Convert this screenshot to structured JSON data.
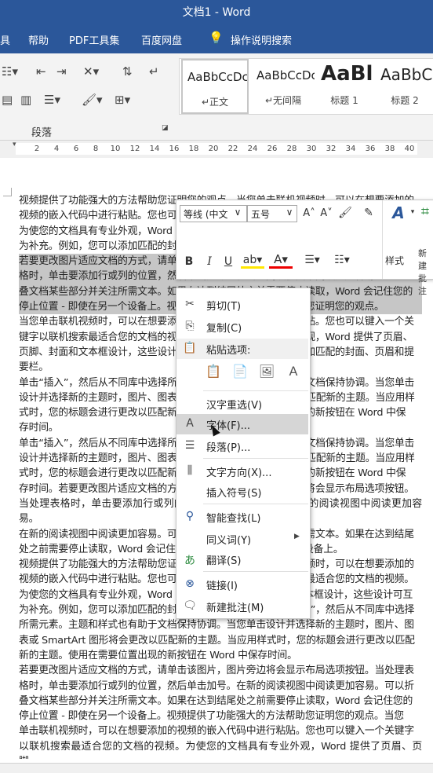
{
  "window": {
    "title": "文档1 - Word"
  },
  "menubar": {
    "items": [
      "具",
      "帮助",
      "PDF工具集",
      "百度网盘",
      "操作说明搜索"
    ]
  },
  "ribbon": {
    "paragraph_label": "段落",
    "styles": [
      {
        "sample": "AaBbCcDc",
        "name": "↵正文"
      },
      {
        "sample": "AaBbCcDc",
        "name": "↵无间隔"
      },
      {
        "sample": "AaBl",
        "name": "标题 1"
      },
      {
        "sample": "AaBbC",
        "name": "标题 2"
      }
    ]
  },
  "ruler": {
    "ticks": [
      "2",
      "4",
      "6",
      "8",
      "10",
      "12",
      "14",
      "16",
      "18",
      "20",
      "22",
      "24",
      "26",
      "28",
      "30",
      "32",
      "34",
      "36",
      "38",
      "40"
    ]
  },
  "document": {
    "lines": [
      "视频提供了功能强大的方法帮助您证明您的观点。当您单击联机视频时，可以在想要添加的",
      "视频的嵌入代码中进行粘贴。您也可以键入一个关键字以联机搜索最适合您的文档的视频。",
      "为使您的文档具有专业外观，Word 提供了页眉、页脚、封面和文本框设计，这些设计可互",
      "为补充。例如，您可以添加匹配的封面、页眉和提要栏。单击“插入”，然后从不同库中选择",
      "若要更改图片适应文档的方式，请单击该图片，图片旁边将会显示布局选项按钮。当处理表",
      "格时，单击要添加行或列的位置，然后单击加号。在新的阅读视图中阅读更加容易。可以折",
      "叠文档某些部分并关注所需文本。如果在达到结尾处之前需要停止读取，Word 会记住您的",
      "停止位置 - 即使在另一个设备上。视频提供了功能强大的方法帮助您证明您的观点。",
      "当您单击联机视频时，可以在想要添加的视频的嵌入代码中进行粘贴。您也可以键入一个关",
      "键字以联机搜索最适合您的文档的视频。为使您的文档具有专业外观，Word 提供了页眉、",
      "页脚、封面和文本框设计，这些设计可互为补充。例如，您可以添加匹配的封面、页眉和提",
      "要栏。",
      "单击“插入”，然后从不同库中选择所需元素。主题和样式也有助于文档保持协调。当您单击",
      "设计并选择新的主题时，图片、图表或 SmartArt 图形将会更改以匹配新的主题。当应用样",
      "式时，您的标题会进行更改以匹配新的主题。使用在需要位置出现的新按钮在 Word 中保",
      "存时间。",
      "单击“插入”，然后从不同库中选择所需元素。主题和样式也有助于文档保持协调。当您单击",
      "设计并选择新的主题时，图片、图表或 SmartArt 图形将会更改以匹配新的主题。当应用样",
      "式时，您的标题会进行更改以匹配新的主题。使用在需要位置出现的新按钮在 Word 中保",
      "存时间。若要更改图片适应文档的方式，请单击该图片，图片旁边将会显示布局选项按钮。",
      "当处理表格时，单击要添加行或列的位置，然后单击加号。在新的阅读视图中阅读更加容易。",
      "在新的阅读视图中阅读更加容易。可以折叠文档某些部分并关注所需文本。如果在达到结尾",
      "处之前需要停止读取，Word 会记住您的停止位置 - 即使在另一个设备上。",
      "视频提供了功能强大的方法帮助您证明您的观点。当您单击联机视频时，可以在想要添加的",
      "视频的嵌入代码中进行粘贴。您也可以键入一个关键字以联机搜索最适合您的文档的视频。",
      "为使您的文档具有专业外观，Word 提供了页眉、页脚、封面和文本框设计，这些设计可互",
      "为补充。例如，您可以添加匹配的封面、页眉和提要栏。单击“插入”，然后从不同库中选择",
      "所需元素。主题和样式也有助于文档保持协调。当您单击设计并选择新的主题时，图片、图",
      "表或 SmartArt 图形将会更改以匹配新的主题。当应用样式时，您的标题会进行更改以匹配",
      "新的主题。使用在需要位置出现的新按钮在 Word 中保存时间。",
      "若要更改图片适应文档的方式，请单击该图片，图片旁边将会显示布局选项按钮。当处理表",
      "格时，单击要添加行或列的位置，然后单击加号。在新的阅读视图中阅读更加容易。可以折",
      "叠文档某些部分并关注所需文本。如果在达到结尾处之前需要停止读取，Word 会记住您的",
      "停止位置 - 即使在另一个设备上。视频提供了功能强大的方法帮助您证明您的观点。当您",
      "单击联机视频时，可以在想要添加的视频的嵌入代码中进行粘贴。您也可以键入一个关键字",
      "以联机搜索最适合您的文档的视频。为使您的文档具有专业外观，Word 提供了页眉、页脚、"
    ]
  },
  "mini_toolbar": {
    "font": "等线 (中文",
    "size": "五号",
    "bold": "B",
    "italic": "I",
    "underline": "U",
    "styles_label": "样式",
    "new_comment_label": "新建批注"
  },
  "context_menu": {
    "cut": "剪切(T)",
    "copy": "复制(C)",
    "paste_header": "粘贴选项:",
    "hanzi": "汉字重选(V)",
    "font": "字体(F)...",
    "paragraph": "段落(P)...",
    "text_direction": "文字方向(X)...",
    "insert_symbol": "插入符号(S)",
    "smart_lookup": "智能查找(L)",
    "synonyms": "同义词(Y)",
    "translate": "翻译(S)",
    "link": "链接(I)",
    "new_comment": "新建批注(M)"
  },
  "colors": {
    "accent": "#2b579a",
    "selection": "#c6c6c6",
    "hover": "#d6d6d6"
  }
}
